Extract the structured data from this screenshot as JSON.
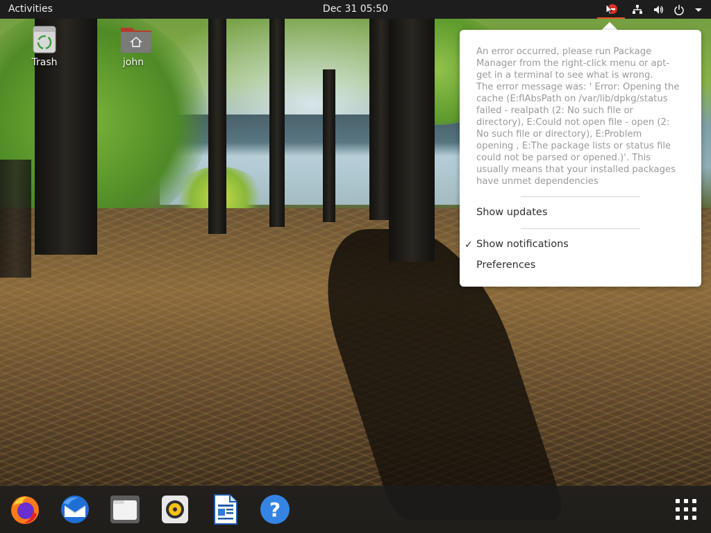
{
  "topbar": {
    "activities_label": "Activities",
    "clock": "Dec 31  05:50"
  },
  "tray": {
    "icons": [
      "software-update-error-icon",
      "network-icon",
      "volume-icon",
      "power-icon",
      "chevron-down-icon"
    ]
  },
  "desktop": {
    "icons": [
      {
        "label": "Trash",
        "icon": "trash-icon"
      },
      {
        "label": "john",
        "icon": "home-folder-icon"
      }
    ]
  },
  "update_menu": {
    "error_text": "An error occurred, please run Package\nManager from the right-click menu or apt-\nget in a terminal to see what is wrong.\nThe error message was: ' Error: Opening the\ncache (E:flAbsPath on /var/lib/dpkg/status\nfailed - realpath (2: No such file or\ndirectory), E:Could not open file  - open (2:\nNo such file or directory), E:Problem\nopening , E:The package lists or status file\ncould not be parsed or opened.)'. This\nusually means that your installed packages\nhave unmet dependencies",
    "show_updates_label": "Show updates",
    "show_notifications_label": "Show notifications",
    "show_notifications_checked": true,
    "check_mark": "✓",
    "preferences_label": "Preferences"
  },
  "dock": {
    "apps": [
      "firefox-icon",
      "thunderbird-icon",
      "files-icon",
      "rhythmbox-icon",
      "libreoffice-writer-icon",
      "help-icon"
    ],
    "show_apps_icon": "app-grid-icon",
    "help_glyph": "?"
  },
  "colors": {
    "topbar_bg": "#1d1d1d",
    "accent": "#e95420",
    "menu_bg": "#ffffff",
    "menu_text": "#2e2e2e",
    "menu_disabled_text": "#9a9a9a"
  }
}
